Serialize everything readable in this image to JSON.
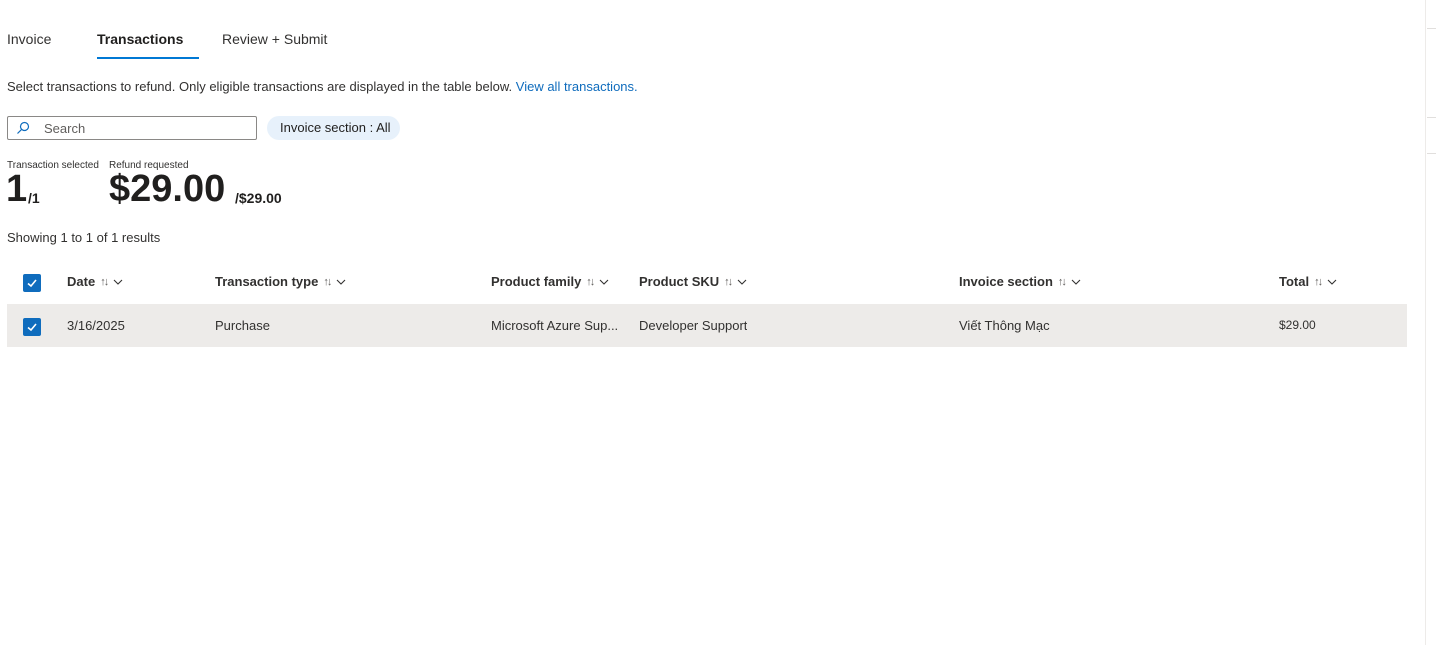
{
  "tabs": [
    {
      "label": "Invoice",
      "active": false
    },
    {
      "label": "Transactions",
      "active": true
    },
    {
      "label": "Review + Submit",
      "active": false
    }
  ],
  "instructions": {
    "text": "Select transactions to refund. Only eligible transactions are displayed in the table below.",
    "link": "View all transactions."
  },
  "search": {
    "placeholder": "Search",
    "icon": "search-icon"
  },
  "filter": {
    "label": "Invoice section : All"
  },
  "stats": {
    "transactions": {
      "label": "Transaction selected",
      "value": "1",
      "total": "/1"
    },
    "refund": {
      "label": "Refund requested",
      "value": "$29.00",
      "total": "/$29.00"
    }
  },
  "results": {
    "text": "Showing 1 to 1 of 1 results"
  },
  "table": {
    "select_all_checked": true,
    "columns": [
      {
        "label": "Date"
      },
      {
        "label": "Transaction type"
      },
      {
        "label": "Product family"
      },
      {
        "label": "Product SKU"
      },
      {
        "label": "Invoice section"
      },
      {
        "label": "Total"
      }
    ],
    "rows": [
      {
        "checked": true,
        "date": "3/16/2025",
        "type": "Purchase",
        "family": "Microsoft Azure Sup...",
        "sku": "Developer Support",
        "section": "Viết Thông Mạc",
        "total": "$29.00"
      }
    ]
  },
  "colors": {
    "accent": "#0f6cbd",
    "tab_underline": "#0078d4",
    "row_selected": "#edebe9",
    "filter_pill": "#e7f1fb"
  }
}
